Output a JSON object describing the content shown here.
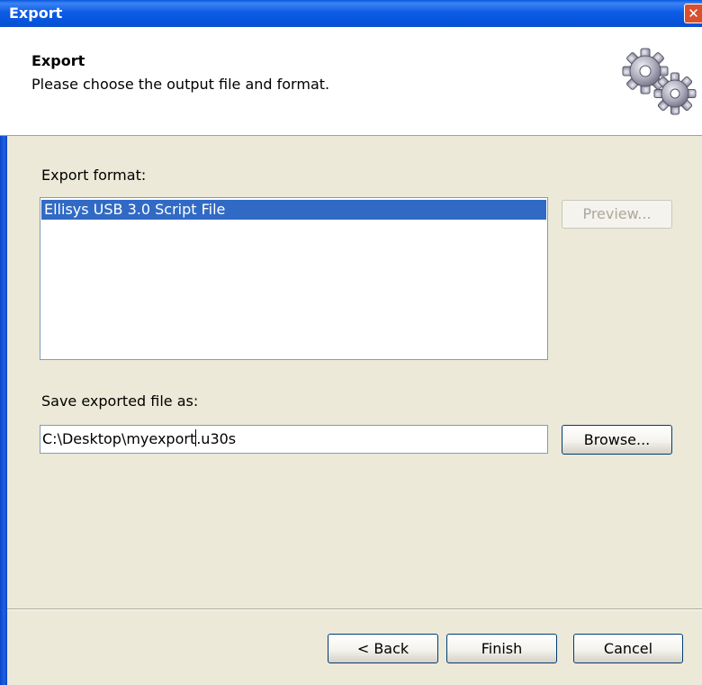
{
  "window": {
    "title": "Export",
    "close_glyph": "✕"
  },
  "header": {
    "title": "Export",
    "subtitle": "Please choose the output file and format.",
    "icon": "gears-icon"
  },
  "format": {
    "label": "Export format:",
    "items": [
      "Ellisys USB 3.0 Script File"
    ],
    "selected_index": 0,
    "preview_button": "Preview..."
  },
  "save": {
    "label": "Save exported file as:",
    "path_before_caret": "C:\\Desktop\\myexport",
    "path_after_caret": ".u30s",
    "browse_button": "Browse..."
  },
  "footer": {
    "back_button": "< Back",
    "finish_button": "Finish",
    "cancel_button": "Cancel"
  },
  "colors": {
    "titlebar": "#0a58e0",
    "selection": "#316ac5",
    "dialog_bg": "#ece9d8"
  }
}
